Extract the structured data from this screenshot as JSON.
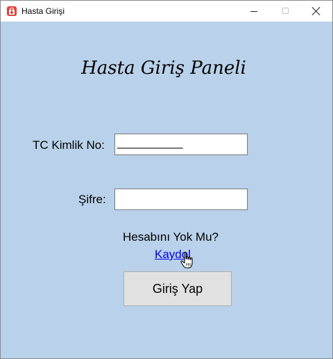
{
  "window": {
    "title": "Hasta Girişi",
    "app_icon": "medical-kit-icon",
    "accent": "#e0443a",
    "client_background": "#b9d1ea"
  },
  "form": {
    "heading": "Hasta Giriş Paneli",
    "tc_label": "TC Kimlik No:",
    "tc_value": "__________",
    "password_label": "Şifre:",
    "password_value": "",
    "no_account_text": "Hesabını Yok Mu?",
    "register_link": "Kaydol",
    "login_button": "Giriş Yap"
  },
  "cursor": "hand-pointer-icon"
}
